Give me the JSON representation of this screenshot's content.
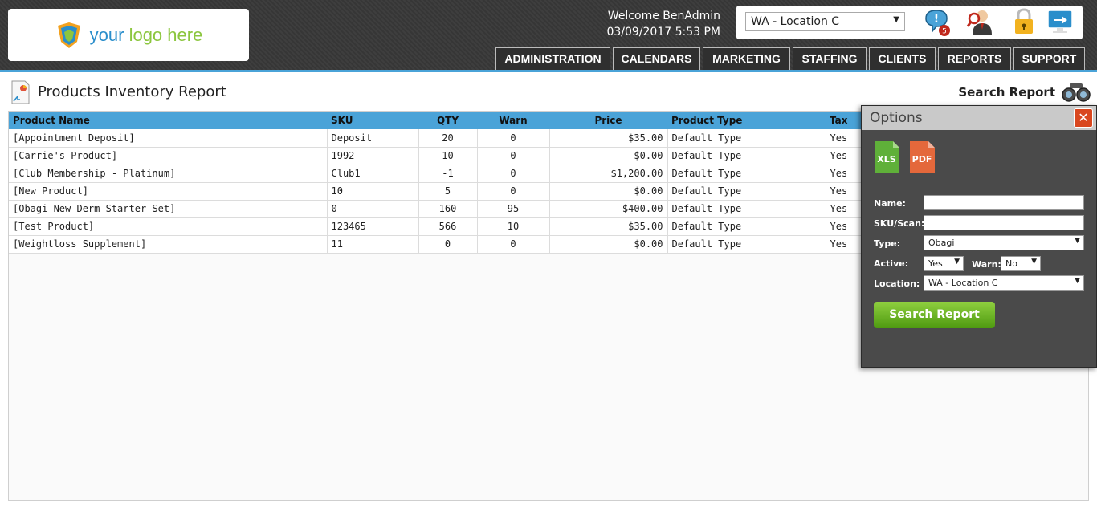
{
  "logo": {
    "word1": "your",
    "word2": "logo here"
  },
  "welcome": {
    "line1": "Welcome BenAdmin",
    "line2": "03/09/2017 5:53 PM"
  },
  "location_select": {
    "value": "WA - Location C"
  },
  "alerts": {
    "count": "5"
  },
  "nav": [
    "ADMINISTRATION",
    "CALENDARS",
    "MARKETING",
    "STAFFING",
    "CLIENTS",
    "REPORTS",
    "SUPPORT"
  ],
  "page": {
    "title": "Products Inventory Report",
    "search_link": "Search Report"
  },
  "table": {
    "headers": [
      "Product Name",
      "SKU",
      "QTY",
      "Warn",
      "Price",
      "Product Type",
      "Tax"
    ],
    "rows": [
      [
        "[Appointment Deposit]",
        "Deposit",
        "20",
        "0",
        "$35.00",
        "Default Type",
        "Yes"
      ],
      [
        "[Carrie's Product]",
        "1992",
        "10",
        "0",
        "$0.00",
        "Default Type",
        "Yes"
      ],
      [
        "[Club Membership - Platinum]",
        "Club1",
        "-1",
        "0",
        "$1,200.00",
        "Default Type",
        "Yes"
      ],
      [
        "[New Product]",
        "10",
        "5",
        "0",
        "$0.00",
        "Default Type",
        "Yes"
      ],
      [
        "[Obagi New Derm Starter Set]",
        "0",
        "160",
        "95",
        "$400.00",
        "Default Type",
        "Yes"
      ],
      [
        "[Test Product]",
        "123465",
        "566",
        "10",
        "$35.00",
        "Default Type",
        "Yes"
      ],
      [
        "[Weightloss Supplement]",
        "11",
        "0",
        "0",
        "$0.00",
        "Default Type",
        "Yes"
      ]
    ]
  },
  "options": {
    "title": "Options",
    "close": "✕",
    "xls": "XLS",
    "pdf": "PDF",
    "name_label": "Name:",
    "name_value": "",
    "sku_label": "SKU/Scan:",
    "sku_value": "",
    "type_label": "Type:",
    "type_value": "Obagi",
    "active_label": "Active:",
    "active_value": "Yes",
    "warn_label": "Warn:",
    "warn_value": "No",
    "location_label": "Location:",
    "location_value": "WA - Location C",
    "search_button": "Search Report"
  },
  "colors": {
    "accent_blue": "#4aa3d8",
    "green_button": "#6cb52a",
    "close_red": "#d9471f"
  }
}
